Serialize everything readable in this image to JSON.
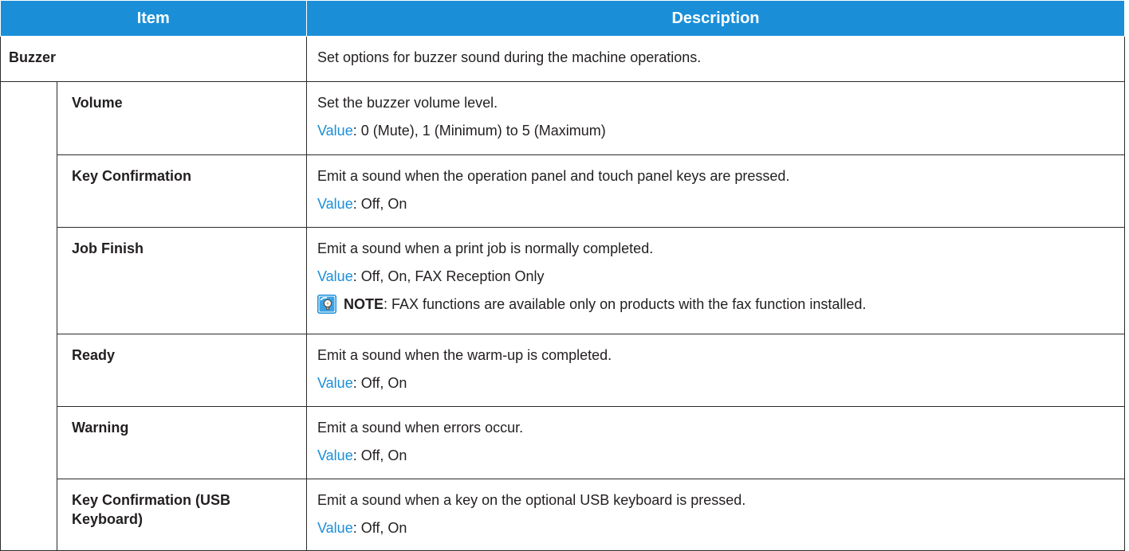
{
  "header": {
    "item_label": "Item",
    "description_label": "Description"
  },
  "buzzer": {
    "label": "Buzzer",
    "description": "Set options for buzzer sound during the machine operations."
  },
  "value_label": "Value",
  "rows": [
    {
      "item": "Volume",
      "description": "Set the buzzer volume level.",
      "value": ": 0 (Mute), 1 (Minimum) to 5 (Maximum)"
    },
    {
      "item": "Key Confirmation",
      "description": "Emit a sound when the operation panel and touch panel keys are pressed.",
      "value": ": Off, On"
    },
    {
      "item": "Job Finish",
      "description": "Emit a sound when a print job is normally completed.",
      "value": ": Off, On, FAX Reception Only",
      "note_label": "NOTE",
      "note_text": ": FAX functions are available only on products with the fax function installed."
    },
    {
      "item": "Ready",
      "description": "Emit a sound when the warm-up is completed.",
      "value": ": Off, On"
    },
    {
      "item": "Warning",
      "description": "Emit a sound when errors occur.",
      "value": ": Off, On"
    },
    {
      "item": "Key Confirmation (USB Keyboard)",
      "description": "Emit a sound when a key on the optional USB keyboard is pressed.",
      "value": ": Off, On"
    }
  ],
  "colors": {
    "header_bg": "#1a8fd8",
    "value_label": "#1a8fd8"
  },
  "icons": {
    "note": "note-lightbulb-icon"
  }
}
